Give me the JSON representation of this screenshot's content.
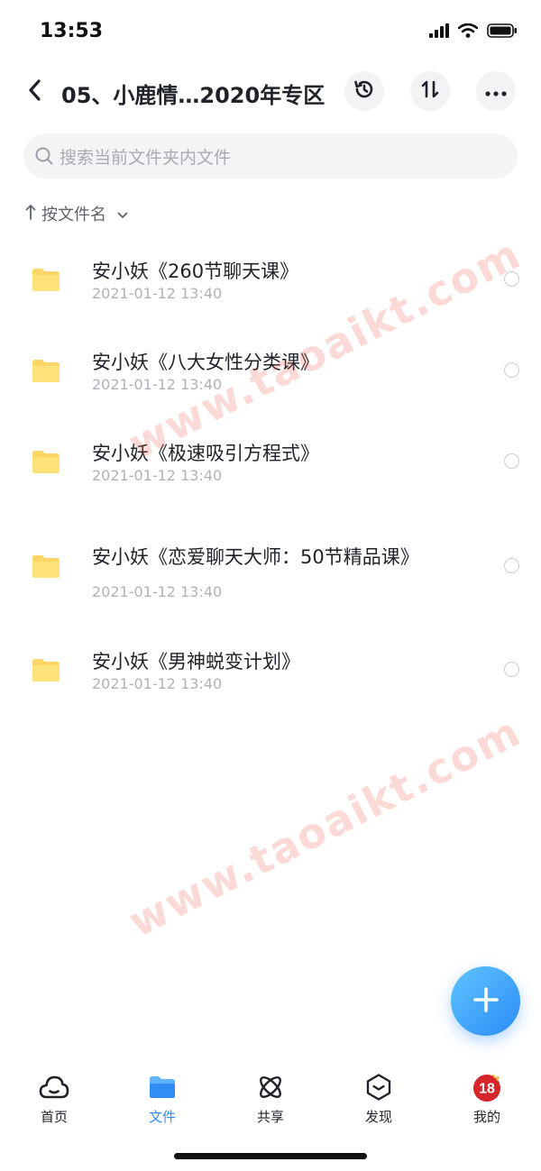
{
  "status": {
    "time": "13:53"
  },
  "nav": {
    "title": "05、小鹿情…2020年专区"
  },
  "search": {
    "placeholder": "搜索当前文件夹内文件"
  },
  "sort": {
    "label": "按文件名"
  },
  "files": [
    {
      "name": "安小妖《260节聊天课》",
      "date": "2021-01-12 13:40"
    },
    {
      "name": "安小妖《八大女性分类课》",
      "date": "2021-01-12 13:40"
    },
    {
      "name": "安小妖《极速吸引方程式》",
      "date": "2021-01-12 13:40"
    },
    {
      "name": "安小妖《恋爱聊天大师：50节精品课》",
      "date": "2021-01-12 13:40"
    },
    {
      "name": "安小妖《男神蜕变计划》",
      "date": "2021-01-12 13:40"
    }
  ],
  "watermark": {
    "text": "www.taoaikt.com"
  },
  "tabs": [
    {
      "label": "首页",
      "icon": "cloud-icon",
      "active": false
    },
    {
      "label": "文件",
      "icon": "folder-icon",
      "active": true
    },
    {
      "label": "共享",
      "icon": "atom-icon",
      "active": false
    },
    {
      "label": "发现",
      "icon": "discover-icon",
      "active": false
    },
    {
      "label": "我的",
      "icon": "avatar-icon",
      "active": false
    }
  ],
  "profile_badge": {
    "text": "18"
  },
  "colors": {
    "accent": "#2f8df5",
    "folder": "#ffd666",
    "watermark": "#e65046"
  }
}
